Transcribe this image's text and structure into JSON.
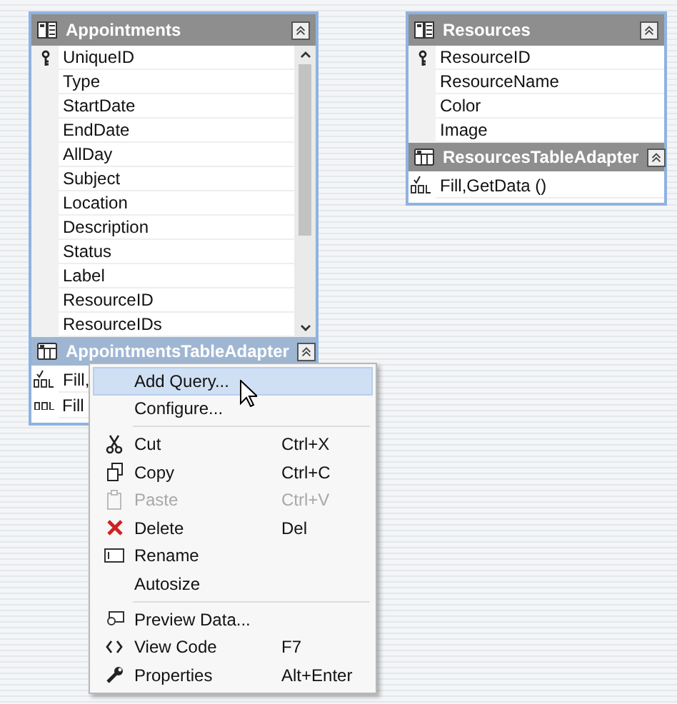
{
  "appointments": {
    "title": "Appointments",
    "fields": [
      {
        "name": "UniqueID",
        "key": true
      },
      {
        "name": "Type",
        "key": false
      },
      {
        "name": "StartDate",
        "key": false
      },
      {
        "name": "EndDate",
        "key": false
      },
      {
        "name": "AllDay",
        "key": false
      },
      {
        "name": "Subject",
        "key": false
      },
      {
        "name": "Location",
        "key": false
      },
      {
        "name": "Description",
        "key": false
      },
      {
        "name": "Status",
        "key": false
      },
      {
        "name": "Label",
        "key": false
      },
      {
        "name": "ResourceID",
        "key": false
      },
      {
        "name": "ResourceIDs",
        "key": false
      }
    ],
    "adapter": {
      "title": "AppointmentsTableAdapter",
      "selected": true,
      "queries": [
        {
          "text": "Fill,",
          "default": true
        },
        {
          "text": "Fill",
          "default": false
        }
      ]
    }
  },
  "resources": {
    "title": "Resources",
    "fields": [
      {
        "name": "ResourceID",
        "key": true
      },
      {
        "name": "ResourceName",
        "key": false
      },
      {
        "name": "Color",
        "key": false
      },
      {
        "name": "Image",
        "key": false
      }
    ],
    "adapter": {
      "title": "ResourcesTableAdapter",
      "selected": false,
      "queries": [
        {
          "text": "Fill,GetData ()",
          "default": true
        }
      ]
    }
  },
  "context_menu": {
    "items": [
      {
        "kind": "item",
        "label": "Add Query...",
        "selected": true,
        "disabled": false
      },
      {
        "kind": "item",
        "label": "Configure...",
        "selected": false,
        "disabled": false
      },
      {
        "kind": "separator"
      },
      {
        "kind": "item",
        "label": "Cut",
        "shortcut": "Ctrl+X",
        "selected": false,
        "disabled": false
      },
      {
        "kind": "item",
        "label": "Copy",
        "shortcut": "Ctrl+C",
        "selected": false,
        "disabled": false
      },
      {
        "kind": "item",
        "label": "Paste",
        "shortcut": "Ctrl+V",
        "selected": false,
        "disabled": true
      },
      {
        "kind": "item",
        "label": "Delete",
        "shortcut": "Del",
        "selected": false,
        "disabled": false
      },
      {
        "kind": "item",
        "label": "Rename",
        "selected": false,
        "disabled": false
      },
      {
        "kind": "item",
        "label": "Autosize",
        "selected": false,
        "disabled": false
      },
      {
        "kind": "separator"
      },
      {
        "kind": "item",
        "label": "Preview Data...",
        "selected": false,
        "disabled": false
      },
      {
        "kind": "item",
        "label": "View Code",
        "shortcut": "F7",
        "selected": false,
        "disabled": false
      },
      {
        "kind": "item",
        "label": "Properties",
        "shortcut": "Alt+Enter",
        "selected": false,
        "disabled": false
      }
    ]
  }
}
